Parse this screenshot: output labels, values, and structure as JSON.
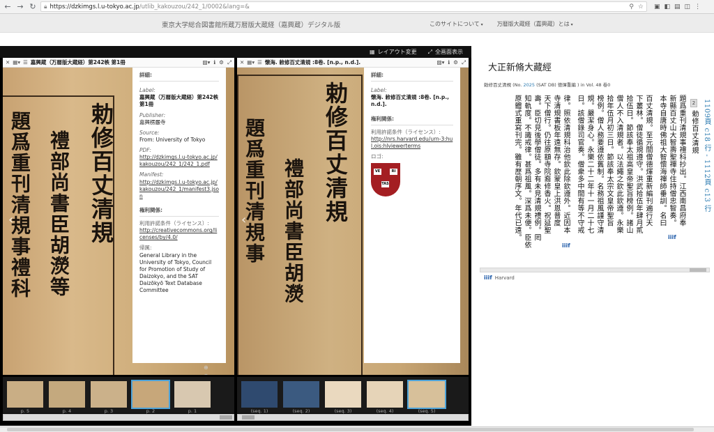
{
  "browser": {
    "url_host": "https://dzkimgs.l.u-tokyo.ac.jp",
    "url_path": "/utlib_kakouzou/242_1/0002&lang=&",
    "back": "←",
    "forward": "→",
    "reload": "↻",
    "home": "⌂",
    "star": "☆",
    "search": "⚲"
  },
  "site": {
    "title": "東京大学総合図書館所蔵万暦版大蔵経（嘉興蔵）デジタル版",
    "nav": [
      "このサイトについて",
      "万暦版大蔵経（嘉興蔵）とは"
    ]
  },
  "viewer": {
    "topbar": {
      "layout": "レイアウト変更",
      "fullscreen": "全画面表示"
    },
    "left_panel": {
      "title": "嘉興蔵（万暦版大蔵経）第242帙 第1冊",
      "page_chars": [
        "勅修百丈清規",
        "禮部尚書臣胡濙等",
        "題爲重刊清規事禮科"
      ],
      "details_heading": "詳細:",
      "label_key": "Label:",
      "label_val": "嘉興蔵（万暦版大蔵経）第242帙 第1冊",
      "publisher_key": "Publisher:",
      "publisher_val": "嘉興楞嚴寺",
      "source_key": "Source:",
      "source_val": "From: University of Tokyo",
      "pdf_key": "PDF:",
      "pdf_val": "http://dzkimgs.l.u-tokyo.ac.jp/kakouzou/242_1/242_1.pdf",
      "manifest_key": "Manifest:",
      "manifest_val": "http://dzkimgs.l.u-tokyo.ac.jp/kakouzou/242_1/manifest3.json",
      "rights_heading": "権利関係:",
      "license_key": "利用許諾条件（ライセンス）:",
      "license_val": "http://creativecommons.org/licenses/by/4.0/",
      "attribution_key": "帰属:",
      "attribution_val": "General Library in the University of Tokyo, Council for Promotion of Study of Daizokyo, and the SAT Daizōkyō Text Database Committee"
    },
    "right_panel": {
      "title": "懷海. 敕修百丈清規 :8卷. [n.p., n.d.].",
      "page_chars": [
        "勅修百丈清規",
        "禮部尚書臣胡濙",
        "題爲重刊清規事"
      ],
      "details_heading": "詳細:",
      "label_key": "Label:",
      "label_val": "懷海. 敕修百丈清規 :8卷. [n.p., n.d.].",
      "rights_heading": "権利関係:",
      "license_key": "利用許諾条件（ライセンス）:",
      "license_val": "http://nrs.harvard.edu/urn-3:hul.ois:hlviewerterms",
      "logo_key": "ロゴ:",
      "logo_books": [
        "VE",
        "RI",
        "TAS"
      ]
    },
    "thumbs_left": [
      "p. 5",
      "p. 4",
      "p. 3",
      "p. 2",
      "p. 1"
    ],
    "thumbs_right": [
      "(seq. 1)",
      "(seq. 2)",
      "(seq. 3)",
      "(seq. 4)",
      "(seq. 5)"
    ]
  },
  "sat": {
    "title": "大正新脩大藏經",
    "sub_prefix": "勅修百丈清規 (No. ",
    "sub_no": "2025",
    "sub_mid": " (SAT DB) 德煇重編 ) in Vol. 48 卷0",
    "page_badge": "2",
    "ref1": "1109頁 c18 行 - 1112頁 c13 行",
    "heading_col": "勅修百丈清規",
    "cols": [
      "題爲重刊清規事禮科抄出。江西南昌府奉",
      "新縣百丈山大智壽聖禪寺住持僧忠智奏。",
      "本寺自唐時佛祖大智懷海禪師垂訓。名曰",
      "百丈清規。至元間僧德煇重新編刊遍行天",
      "下叢林。僧徒循規遵守。洪武拾伍年肆月貳",
      "拾伍日。節該奉太祖高皇帝聖旨榜例。諸山",
      "僧人不入清規者。以法繩之欽此欽遵。永樂",
      "拾年伍月初三日。節該奉太宗文皇帝聖旨",
      "榜例。僧人務要遵依舊制。名務祖風謹守清",
      "規。嚴潔身心。永樂二十二年十一月二十七",
      "日。該僧錄司官奏。僧衆多中間有等不守戒",
      "律。照依清規科治他欽此除欽遵外。近因本",
      "寺清規書板年遠無存。欽蒙皇上洪恩普度",
      "天下僧行。仍往原額寺院裔修香火。祝延聖",
      "壽。臣切見後學僧徒。多有未見清規禮例。罔",
      "知軌度。不識戒律。甚爲祖風。深爲未便。臣依",
      "原體式重寫刊完。雖有歴朝序文。年代已遠。"
    ],
    "harvard": "Harvard",
    "iiif": "iiif"
  }
}
